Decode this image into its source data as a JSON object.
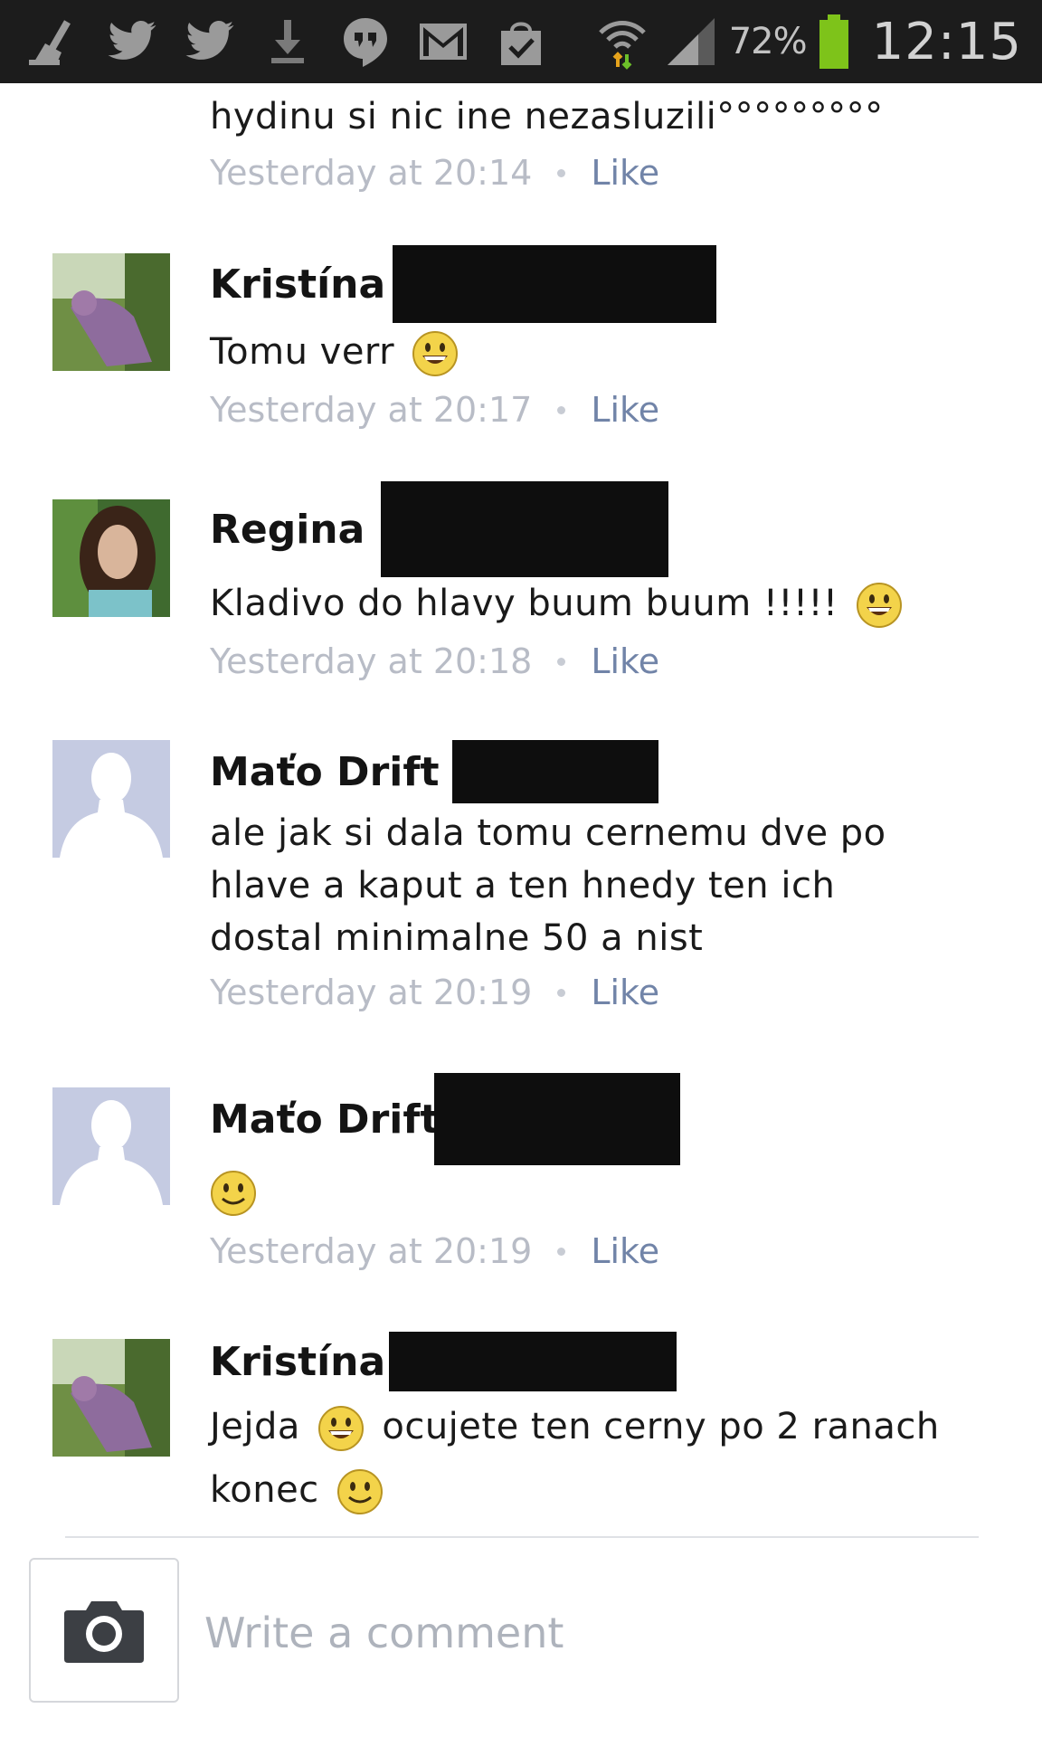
{
  "status_bar": {
    "battery_percent": "72%",
    "time": "12:15",
    "icons": [
      "broom-icon",
      "twitter-icon",
      "twitter-icon",
      "download-icon",
      "hangouts-icon",
      "gmail-icon",
      "shopping-bag-icon",
      "wifi-icon",
      "signal-icon",
      "battery-icon"
    ]
  },
  "fragment": {
    "text": "hydinu si nic ine nezasluzili°°°°°°°°°",
    "timestamp": "Yesterday at 20:14",
    "like": "Like"
  },
  "comments": [
    {
      "name": "Kristína",
      "text": "Tomu verr",
      "timestamp": "Yesterday at 20:17",
      "like": "Like",
      "avatar": "photo-avatar"
    },
    {
      "name": "Regina",
      "text": "Kladivo do hlavy buum buum !!!!!",
      "timestamp": "Yesterday at 20:18",
      "like": "Like",
      "avatar": "photo-avatar"
    },
    {
      "name": "Maťo Drift",
      "text": "ale jak si dala tomu cernemu dve po hlave a kaput a ten hnedy ten ich dostal minimalne 50 a nist",
      "timestamp": "Yesterday at 20:19",
      "like": "Like",
      "avatar": "default-silhouette-avatar"
    },
    {
      "name": "Maťo Drift",
      "text": "",
      "timestamp": "Yesterday at 20:19",
      "like": "Like",
      "avatar": "default-silhouette-avatar"
    },
    {
      "name": "Kristína",
      "text_part1": "Jejda",
      "text_part2": "ocujete ten cerny po 2 ranach konec",
      "avatar": "photo-avatar"
    }
  ],
  "composer": {
    "placeholder": "Write a comment",
    "camera_icon": "camera-icon"
  },
  "colors": {
    "status_bar_bg": "#1c1c1c",
    "meta_gray": "#b8bcc6",
    "like_link": "#7184a8",
    "battery_green": "#7ec31a"
  }
}
